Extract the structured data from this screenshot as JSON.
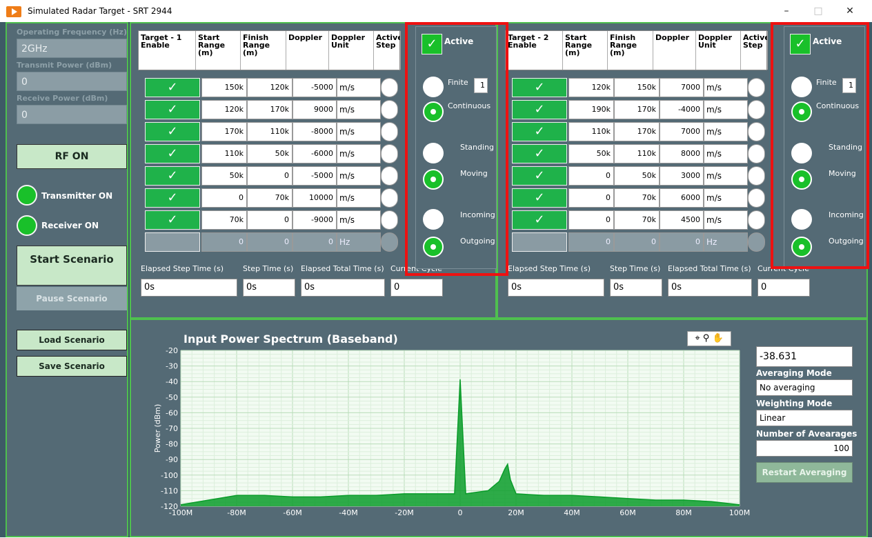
{
  "window": {
    "title": "Simulated Radar Target - SRT 2944",
    "minimize": "–",
    "maximize": "□",
    "close": "✕"
  },
  "left": {
    "op_freq_label": "Operating Frequency (Hz)",
    "op_freq_value": "2GHz",
    "tx_power_label": "Transmit Power (dBm)",
    "tx_power_value": "0",
    "rx_power_label": "Receive Power (dBm)",
    "rx_power_value": "0",
    "rf_on": "RF ON",
    "transmitter_on": "Transmitter ON",
    "receiver_on": "Receiver ON",
    "start_scenario": "Start Scenario",
    "pause_scenario": "Pause Scenario",
    "load_scenario": "Load Scenario",
    "save_scenario": "Save Scenario"
  },
  "target1": {
    "headers": [
      "Target - 1 Enable",
      "Start Range (m)",
      "Finish Range (m)",
      "Doppler",
      "Doppler Unit",
      "Active Step"
    ],
    "rows": [
      {
        "start": "150k",
        "finish": "120k",
        "doppler": "-5000",
        "unit": "m/s"
      },
      {
        "start": "120k",
        "finish": "170k",
        "doppler": "9000",
        "unit": "m/s"
      },
      {
        "start": "170k",
        "finish": "110k",
        "doppler": "-8000",
        "unit": "m/s"
      },
      {
        "start": "110k",
        "finish": "50k",
        "doppler": "-6000",
        "unit": "m/s"
      },
      {
        "start": "50k",
        "finish": "0",
        "doppler": "-5000",
        "unit": "m/s"
      },
      {
        "start": "0",
        "finish": "70k",
        "doppler": "10000",
        "unit": "m/s"
      },
      {
        "start": "70k",
        "finish": "0",
        "doppler": "-9000",
        "unit": "m/s"
      },
      {
        "start": "0",
        "finish": "0",
        "doppler": "0",
        "unit": "Hz"
      }
    ],
    "controls": {
      "active": "Active",
      "finite": "Finite",
      "finite_count": "1",
      "continuous": "Continuous",
      "standing": "Standing",
      "moving": "Moving",
      "incoming": "Incoming",
      "outgoing": "Outgoing"
    },
    "elapsed_step_label": "Elapsed Step Time (s)",
    "step_time_label": "Step Time (s)",
    "elapsed_total_label": "Elapsed Total Time (s)",
    "current_cycle_label": "Current Cycle",
    "elapsed_step_value": "0s",
    "step_time_value": "0s",
    "elapsed_total_value": "0s",
    "current_cycle_value": "0"
  },
  "target2": {
    "headers": [
      "Target - 2 Enable",
      "Start Range (m)",
      "Finish Range (m)",
      "Doppler",
      "Doppler Unit",
      "Active Step"
    ],
    "rows": [
      {
        "start": "120k",
        "finish": "150k",
        "doppler": "7000",
        "unit": "m/s"
      },
      {
        "start": "190k",
        "finish": "170k",
        "doppler": "-4000",
        "unit": "m/s"
      },
      {
        "start": "110k",
        "finish": "170k",
        "doppler": "7000",
        "unit": "m/s"
      },
      {
        "start": "50k",
        "finish": "110k",
        "doppler": "8000",
        "unit": "m/s"
      },
      {
        "start": "0",
        "finish": "50k",
        "doppler": "3000",
        "unit": "m/s"
      },
      {
        "start": "0",
        "finish": "70k",
        "doppler": "6000",
        "unit": "m/s"
      },
      {
        "start": "0",
        "finish": "70k",
        "doppler": "4500",
        "unit": "m/s"
      },
      {
        "start": "0",
        "finish": "0",
        "doppler": "0",
        "unit": "Hz"
      }
    ],
    "controls": {
      "active": "Active",
      "finite": "Finite",
      "finite_count": "1",
      "continuous": "Continuous",
      "standing": "Standing",
      "moving": "Moving",
      "incoming": "Incoming",
      "outgoing": "Outgoing"
    },
    "elapsed_step_label": "Elapsed Step Time (s)",
    "step_time_label": "Step Time (s)",
    "elapsed_total_label": "Elapsed Total Time (s)",
    "current_cycle_label": "Current Cycle",
    "elapsed_step_value": "0s",
    "step_time_value": "0s",
    "elapsed_total_value": "0s",
    "current_cycle_value": "0"
  },
  "spectrum": {
    "value_readout": "-38.631",
    "averaging_mode_label": "Averaging Mode",
    "averaging_mode_value": "No averaging",
    "weighting_mode_label": "Weighting Mode",
    "weighting_mode_value": "Linear",
    "num_averages_label": "Number of Avearages",
    "num_averages_value": "100",
    "restart_averaging": "Restart Averaging",
    "tool_icons": [
      "crosshair-icon",
      "zoom-icon",
      "pan-hand-icon"
    ]
  },
  "chart_data": {
    "type": "line",
    "title": "Input Power Spectrum (Baseband)",
    "xlabel": "",
    "ylabel": "Power (dBm)",
    "xlim": [
      -100000000,
      100000000
    ],
    "ylim": [
      -120,
      -20
    ],
    "x_ticks": [
      "-100M",
      "-80M",
      "-60M",
      "-40M",
      "-20M",
      "0",
      "20M",
      "40M",
      "60M",
      "80M",
      "100M"
    ],
    "y_ticks": [
      "-20",
      "-30",
      "-40",
      "-50",
      "-60",
      "-70",
      "-80",
      "-90",
      "-100",
      "-110",
      "-120"
    ],
    "grid": true,
    "series": [
      {
        "color": "#0a9c2a",
        "x": [
          -100,
          -90,
          -80,
          -70,
          -60,
          -50,
          -40,
          -30,
          -20,
          -10,
          -2,
          0,
          2,
          10,
          14,
          16,
          17,
          18,
          20,
          30,
          40,
          50,
          60,
          70,
          80,
          90,
          100
        ],
        "y": [
          -119,
          -116,
          -113,
          -113,
          -114,
          -114,
          -113,
          -113,
          -112,
          -112,
          -112,
          -38.6,
          -112,
          -110,
          -104,
          -96,
          -93,
          -103,
          -112,
          -113,
          -113,
          -114,
          -115,
          -116,
          -116,
          -117,
          -119
        ]
      }
    ]
  }
}
